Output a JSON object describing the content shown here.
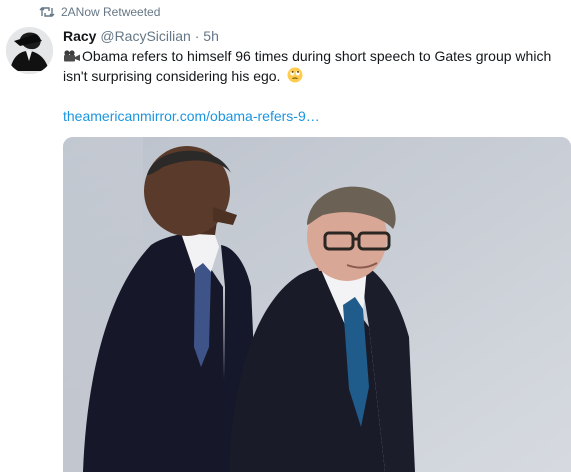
{
  "retweet_banner": {
    "icon": "retweet-icon",
    "text": "2ANow Retweeted"
  },
  "tweet": {
    "author": {
      "display_name": "Racy",
      "handle": "@RacySicilian",
      "separator": "·",
      "time": "5h"
    },
    "text_icon": "movie-camera-icon",
    "text": "Obama refers to himself 96 times during short speech to Gates group which isn't surprising considering his ego.",
    "emoji": "rolling-eyes-emoji",
    "link": "theamericanmirror.com/obama-refers-9…",
    "media": {
      "type": "photo",
      "subject": "two men in dark suits walking"
    }
  },
  "colors": {
    "link": "#1b95e0",
    "muted": "#657786",
    "text": "#14171a"
  }
}
